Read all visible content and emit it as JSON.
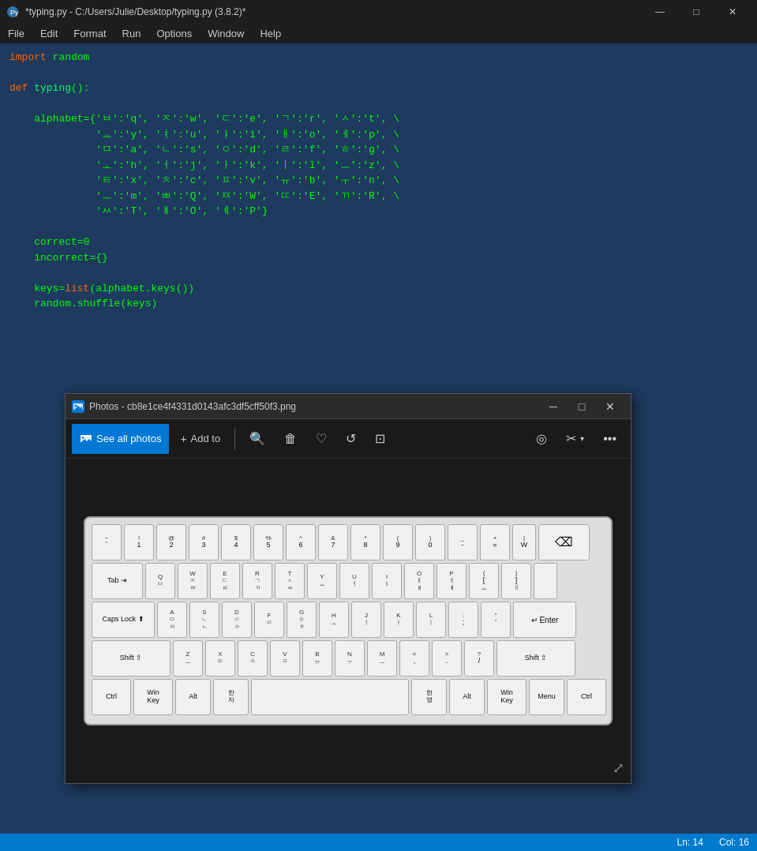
{
  "titlebar": {
    "title": "*typing.py - C:/Users/Julie/Desktop/typing.py (3.8.2)*",
    "icon": "python",
    "minimize": "—",
    "maximize": "□",
    "close": "✕"
  },
  "menubar": {
    "items": [
      "File",
      "Edit",
      "Format",
      "Run",
      "Options",
      "Window",
      "Help"
    ]
  },
  "code": {
    "lines": [
      "import random",
      "",
      "def typing():",
      "",
      "    alphabet={'ㅂ':'q', 'ㅈ':'w', 'ㄷ':'e', 'ㄱ':'r', 'ㅅ':'t', \\",
      "              'ㅛ':'y', 'ㅕ':'u', 'ㅑ':'i', 'ㅐ':'o', 'ㅔ':'p', \\",
      "              'ㅁ':'a', 'ㄴ':'s', 'ㅇ':'d', 'ㄹ':'f', 'ㅎ':'g', \\",
      "              'ㅗ':'h', 'ㅓ':'j', 'ㅏ':'k', 'ㅣ':'l', 'ㅡ':'z', \\",
      "              'ㅌ':'x', 'ㅊ':'c', 'ㅍ':'v', 'ㅠ':'b', 'ㅜ':'n', \\",
      "              'ㅡ':'m', 'ㅃ':'Q', 'ㅉ':'W', 'ㄸ':'E', 'ㄲ':'R', \\",
      "              'ㅆ':'T', 'ㅒ':'O', 'ㅖ':'P'}",
      "",
      "    correct=0",
      "    incorrect={}",
      "",
      "    keys=list(alphabet.keys())",
      "    random.shuffle(keys)"
    ]
  },
  "photos_window": {
    "title": "Photos - cb8e1ce4f4331d0143afc3df5cff50f3.png",
    "toolbar": {
      "see_all_photos": "See all photos",
      "add_to": "Add to",
      "zoom_icon": "zoom",
      "delete_icon": "delete",
      "heart_icon": "heart",
      "rotate_icon": "rotate",
      "crop_icon": "crop",
      "enhance_icon": "enhance",
      "edit_icon": "edit",
      "more_icon": "more"
    }
  },
  "statusbar": {
    "ln": "Ln: 14",
    "col": "Col: 16"
  }
}
